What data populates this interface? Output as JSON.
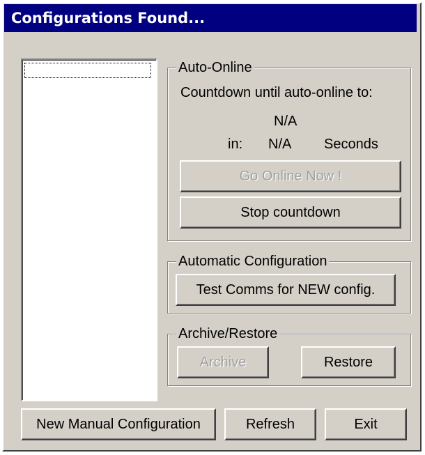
{
  "window": {
    "title": "Configurations Found..."
  },
  "auto_online": {
    "legend": "Auto-Online",
    "countdown_label": "Countdown until auto-online to:",
    "target_value": "N/A",
    "in_label": "in:",
    "seconds_value": "N/A",
    "seconds_unit": "Seconds",
    "go_online_label": "Go Online Now !",
    "stop_countdown_label": "Stop countdown"
  },
  "automatic_config": {
    "legend": "Automatic Configuration",
    "test_comms_label": "Test Comms for NEW config."
  },
  "archive_restore": {
    "legend": "Archive/Restore",
    "archive_label": "Archive",
    "restore_label": "Restore"
  },
  "footer": {
    "new_manual_label": "New Manual Configuration",
    "refresh_label": "Refresh",
    "exit_label": "Exit"
  }
}
